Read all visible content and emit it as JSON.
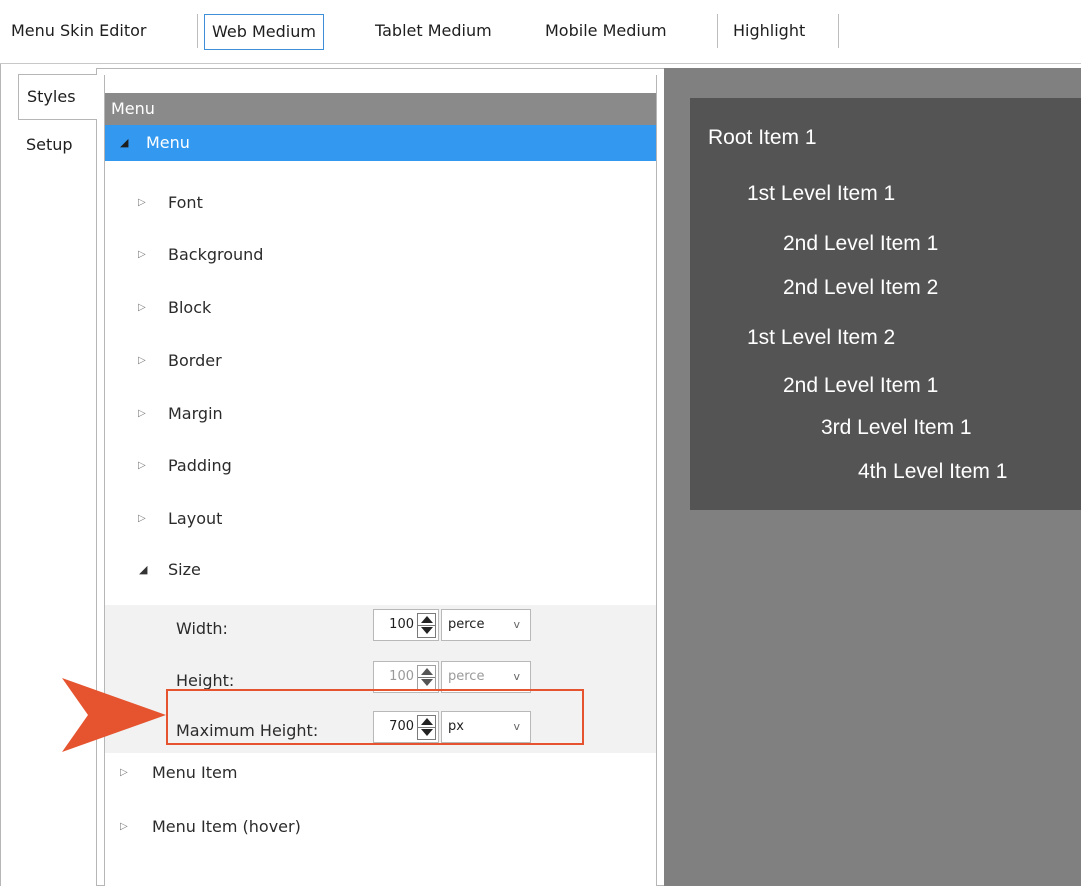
{
  "top_tabs": [
    {
      "label": "Menu Skin Editor",
      "selected": false
    },
    {
      "label": "Web Medium",
      "selected": true
    },
    {
      "label": "Tablet Medium",
      "selected": false
    },
    {
      "label": "Mobile Medium",
      "selected": false
    },
    {
      "label": "Highlight",
      "selected": false
    }
  ],
  "side_tabs": [
    {
      "label": "Styles",
      "selected": true
    },
    {
      "label": "Setup",
      "selected": false
    }
  ],
  "panel": {
    "header": "Menu",
    "tree": {
      "root": {
        "label": "Menu",
        "expanded": true,
        "selected": true
      },
      "children": [
        {
          "label": "Font",
          "expanded": false
        },
        {
          "label": "Background",
          "expanded": false
        },
        {
          "label": "Block",
          "expanded": false
        },
        {
          "label": "Border",
          "expanded": false
        },
        {
          "label": "Margin",
          "expanded": false
        },
        {
          "label": "Padding",
          "expanded": false
        },
        {
          "label": "Layout",
          "expanded": false
        },
        {
          "label": "Size",
          "expanded": true
        }
      ],
      "size_properties": [
        {
          "label": "Width:",
          "value": "100",
          "unit": "perce",
          "enabled": true
        },
        {
          "label": "Height:",
          "value": "100",
          "unit": "perce",
          "enabled": false
        },
        {
          "label": "Maximum Height:",
          "value": "700",
          "unit": "px",
          "enabled": true,
          "highlighted": true
        }
      ],
      "siblings": [
        {
          "label": "Menu Item",
          "expanded": false
        },
        {
          "label": "Menu Item (hover)",
          "expanded": false
        }
      ]
    }
  },
  "preview": {
    "items": [
      {
        "label": "Root Item 1",
        "level": 0
      },
      {
        "label": "1st Level Item 1",
        "level": 1
      },
      {
        "label": "2nd Level Item 1",
        "level": 2
      },
      {
        "label": "2nd Level Item 2",
        "level": 2
      },
      {
        "label": "1st Level Item 2",
        "level": 1
      },
      {
        "label": "2nd Level Item 1",
        "level": 2
      },
      {
        "label": "3rd Level Item 1",
        "level": 3
      },
      {
        "label": "4th Level Item 1",
        "level": 4
      }
    ]
  },
  "colors": {
    "selection": "#3399f0",
    "callout": "#e5542f",
    "preview_background": "#808080",
    "preview_menu": "#545454"
  },
  "icons": {
    "expanded": "expanded-triangle-icon",
    "collapsed": "collapsed-triangle-icon",
    "spinner": "spin-arrows-icon",
    "dropdown": "chevron-down-icon",
    "callout": "arrow-pointer-icon"
  }
}
